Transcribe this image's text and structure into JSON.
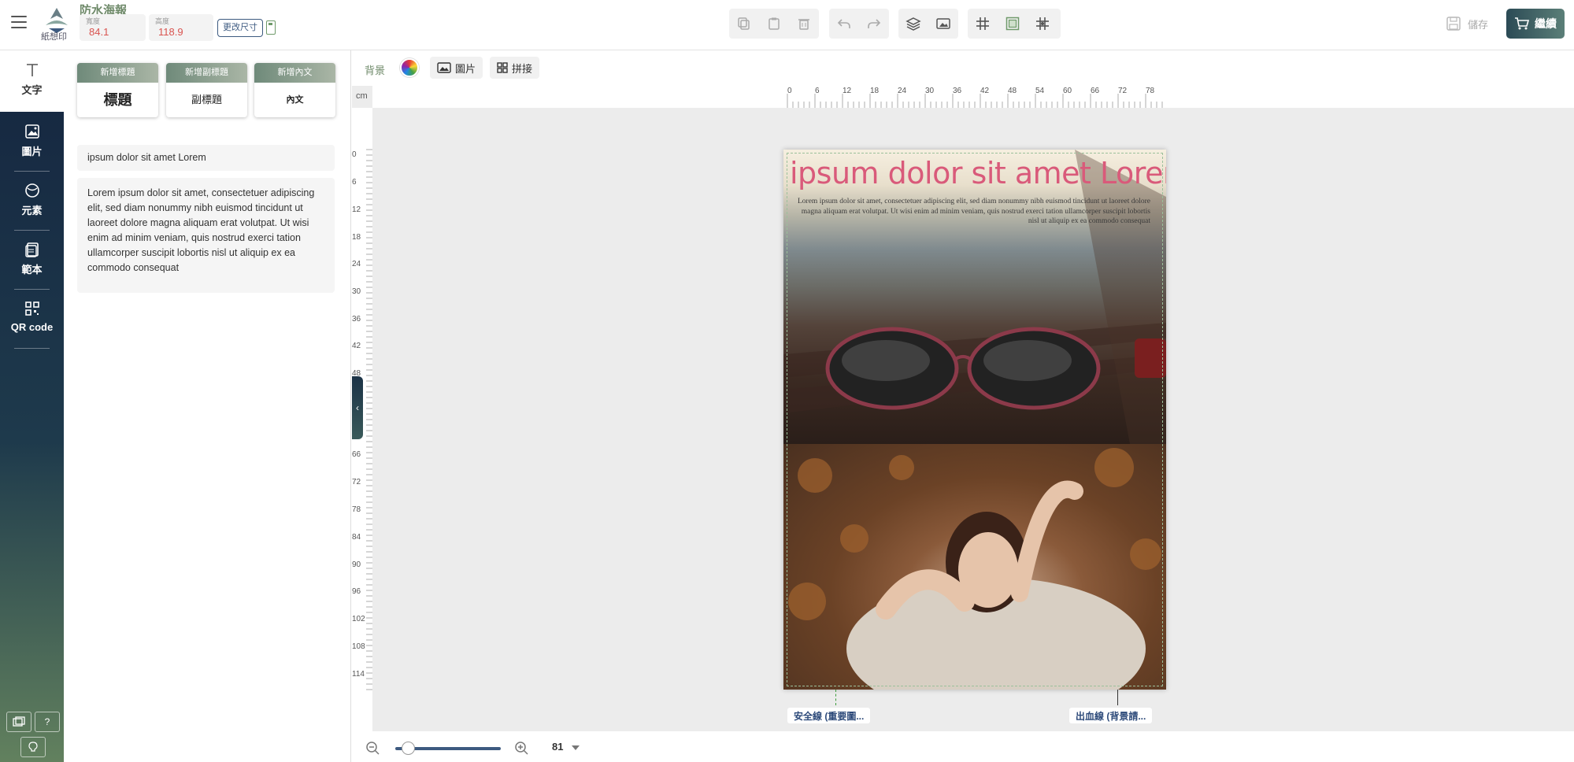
{
  "header": {
    "brand": "紙想印",
    "doc_title": "防水海報",
    "width_label": "寬度",
    "width_value": "84.1",
    "height_label": "高度",
    "height_value": "118.9",
    "resize_label": "更改尺寸",
    "save_label": "儲存",
    "continue_label": "繼續"
  },
  "nav": {
    "items": [
      {
        "label": "文字",
        "icon": "text-icon"
      },
      {
        "label": "圖片",
        "icon": "image-icon"
      },
      {
        "label": "元素",
        "icon": "element-icon"
      },
      {
        "label": "範本",
        "icon": "template-icon"
      },
      {
        "label": "QR code",
        "icon": "qr-code-icon"
      }
    ],
    "help_label": "?"
  },
  "panel": {
    "cards": [
      {
        "head": "新增標題",
        "body": "標題"
      },
      {
        "head": "新增副標題",
        "body": "副標題"
      },
      {
        "head": "新增內文",
        "body": "內文"
      }
    ],
    "title_text": "ipsum dolor sit amet Lorem",
    "body_text": "Lorem ipsum dolor sit amet, consectetuer adipiscing elit, sed diam nonummy nibh euismod tincidunt ut\nlaoreet dolore magna aliquam erat volutpat. Ut wisi enim ad minim veniam, quis nostrud exerci tation ullamcorper suscipit lobortis nisl ut aliquip ex ea commodo consequat"
  },
  "subbar": {
    "background_label": "背景",
    "image_label": "圖片",
    "collage_label": "拼接"
  },
  "ruler": {
    "unit": "cm",
    "top_ticks": [
      "0",
      "6",
      "12",
      "18",
      "24",
      "30",
      "36",
      "42",
      "48",
      "54",
      "60",
      "66",
      "72",
      "78"
    ],
    "left_ticks": [
      "0",
      "6",
      "12",
      "18",
      "24",
      "30",
      "36",
      "42",
      "48",
      "66",
      "72",
      "78",
      "84",
      "90",
      "96",
      "102",
      "108",
      "114"
    ]
  },
  "poster": {
    "title": "ipsum dolor sit amet Lorem",
    "body": "Lorem ipsum dolor sit amet, consectetuer adipiscing elit, sed diam nonummy nibh euismod tincidunt ut laoreet dolore magna aliquam erat volutpat. Ut wisi enim ad minim veniam, quis nostrud exerci tation ullamcorper suscipit lobortis nisl ut aliquip ex ea commodo consequat"
  },
  "guides": {
    "safe_label": "安全線 (重要圖...",
    "bleed_label": "出血線 (背景請..."
  },
  "zoom": {
    "value": "81",
    "level": 0.12
  },
  "colors": {
    "accent": "#3d5a80",
    "brand_green": "#6f8a6a",
    "title_pink": "#d95a7a"
  }
}
